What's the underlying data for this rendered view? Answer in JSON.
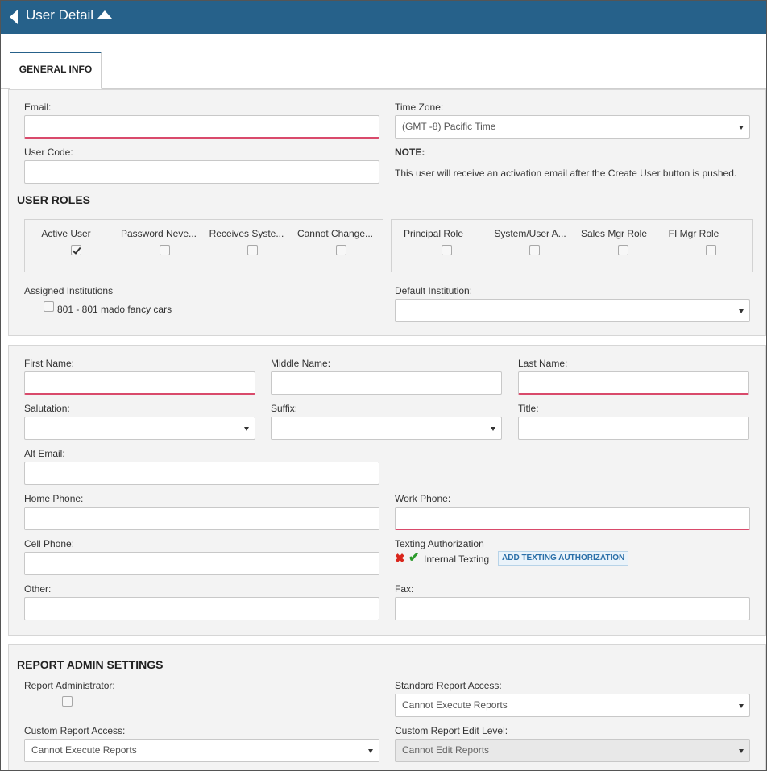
{
  "header": {
    "title": "User Detail"
  },
  "tabs": [
    {
      "label": "GENERAL INFO"
    }
  ],
  "account": {
    "email_label": "Email:",
    "email_value": "",
    "timezone_label": "Time Zone:",
    "timezone_value": "(GMT -8) Pacific Time",
    "usercode_label": "User Code:",
    "usercode_value": "",
    "note_title": "NOTE:",
    "note_text": "This user will receive an activation email after the Create User button is pushed."
  },
  "roles": {
    "title": "USER ROLES",
    "left": [
      {
        "label": "Active User",
        "checked": true
      },
      {
        "label": "Password Neve...",
        "checked": false
      },
      {
        "label": "Receives Syste...",
        "checked": false
      },
      {
        "label": "Cannot Change...",
        "checked": false
      }
    ],
    "right": [
      {
        "label": "Principal Role",
        "checked": false
      },
      {
        "label": "System/User A...",
        "checked": false
      },
      {
        "label": "Sales Mgr Role",
        "checked": false
      },
      {
        "label": "FI Mgr Role",
        "checked": false
      }
    ],
    "assigned_label": "Assigned Institutions",
    "assigned_item": "801 - 801 mado fancy cars",
    "default_label": "Default Institution:",
    "default_value": ""
  },
  "contact": {
    "first_name_label": "First Name:",
    "middle_name_label": "Middle Name:",
    "last_name_label": "Last Name:",
    "salutation_label": "Salutation:",
    "suffix_label": "Suffix:",
    "title_label": "Title:",
    "alt_email_label": "Alt Email:",
    "home_phone_label": "Home Phone:",
    "work_phone_label": "Work Phone:",
    "cell_phone_label": "Cell Phone:",
    "texting_label": "Texting Authorization",
    "texting_item": "Internal Texting",
    "texting_button": "ADD TEXTING AUTHORIZATION",
    "other_label": "Other:",
    "fax_label": "Fax:"
  },
  "report": {
    "title": "REPORT ADMIN SETTINGS",
    "admin_label": "Report Administrator:",
    "standard_label": "Standard Report Access:",
    "standard_value": "Cannot Execute Reports",
    "custom_label": "Custom Report Access:",
    "custom_value": "Cannot Execute Reports",
    "edit_label": "Custom Report Edit Level:",
    "edit_value": "Cannot Edit Reports"
  },
  "colors": {
    "header_bg": "#26618a",
    "required_underline": "#d94a6b",
    "panel_bg": "#f3f3f3"
  }
}
